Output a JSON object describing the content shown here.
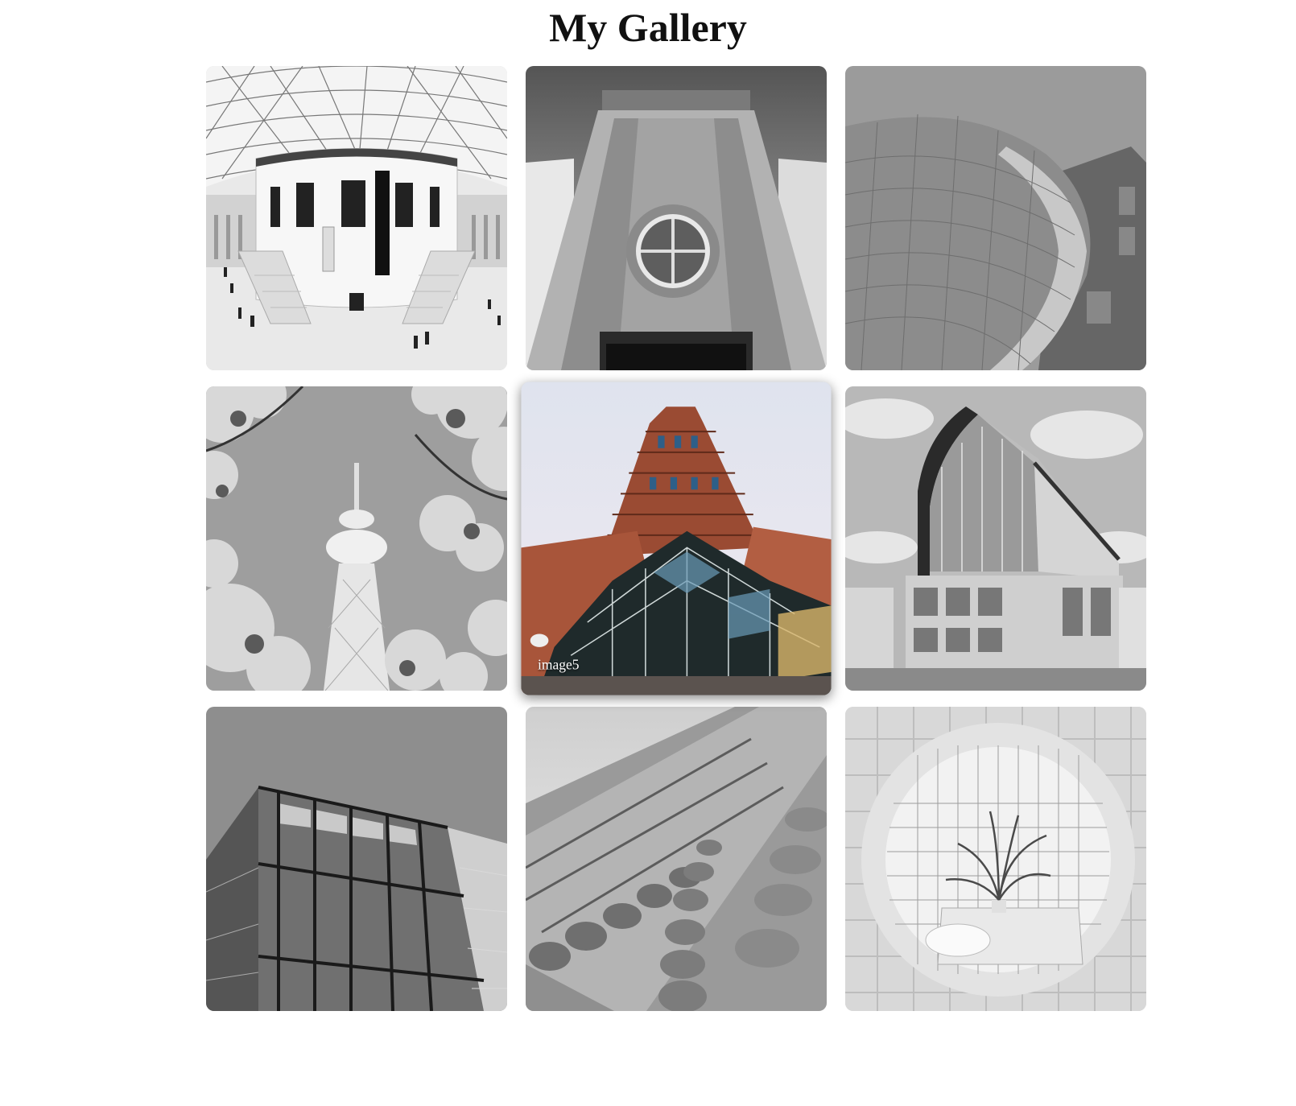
{
  "page": {
    "title": "My Gallery"
  },
  "gallery": {
    "images": [
      {
        "subject": "domed-atrium",
        "tone": "grayscale"
      },
      {
        "subject": "stone-doorway-round-window",
        "tone": "grayscale"
      },
      {
        "subject": "curved-metal-facade",
        "tone": "grayscale"
      },
      {
        "subject": "tv-tower-with-blossoms",
        "tone": "grayscale"
      },
      {
        "subject": "brick-skyscraper-glass-atrium",
        "tone": "color",
        "caption": "image5",
        "hovered": true
      },
      {
        "subject": "curved-glass-office-building",
        "tone": "grayscale"
      },
      {
        "subject": "glass-curtain-wall",
        "tone": "grayscale"
      },
      {
        "subject": "ornate-stone-facade",
        "tone": "grayscale"
      },
      {
        "subject": "round-window-tiled-room-palm",
        "tone": "grayscale"
      }
    ]
  }
}
